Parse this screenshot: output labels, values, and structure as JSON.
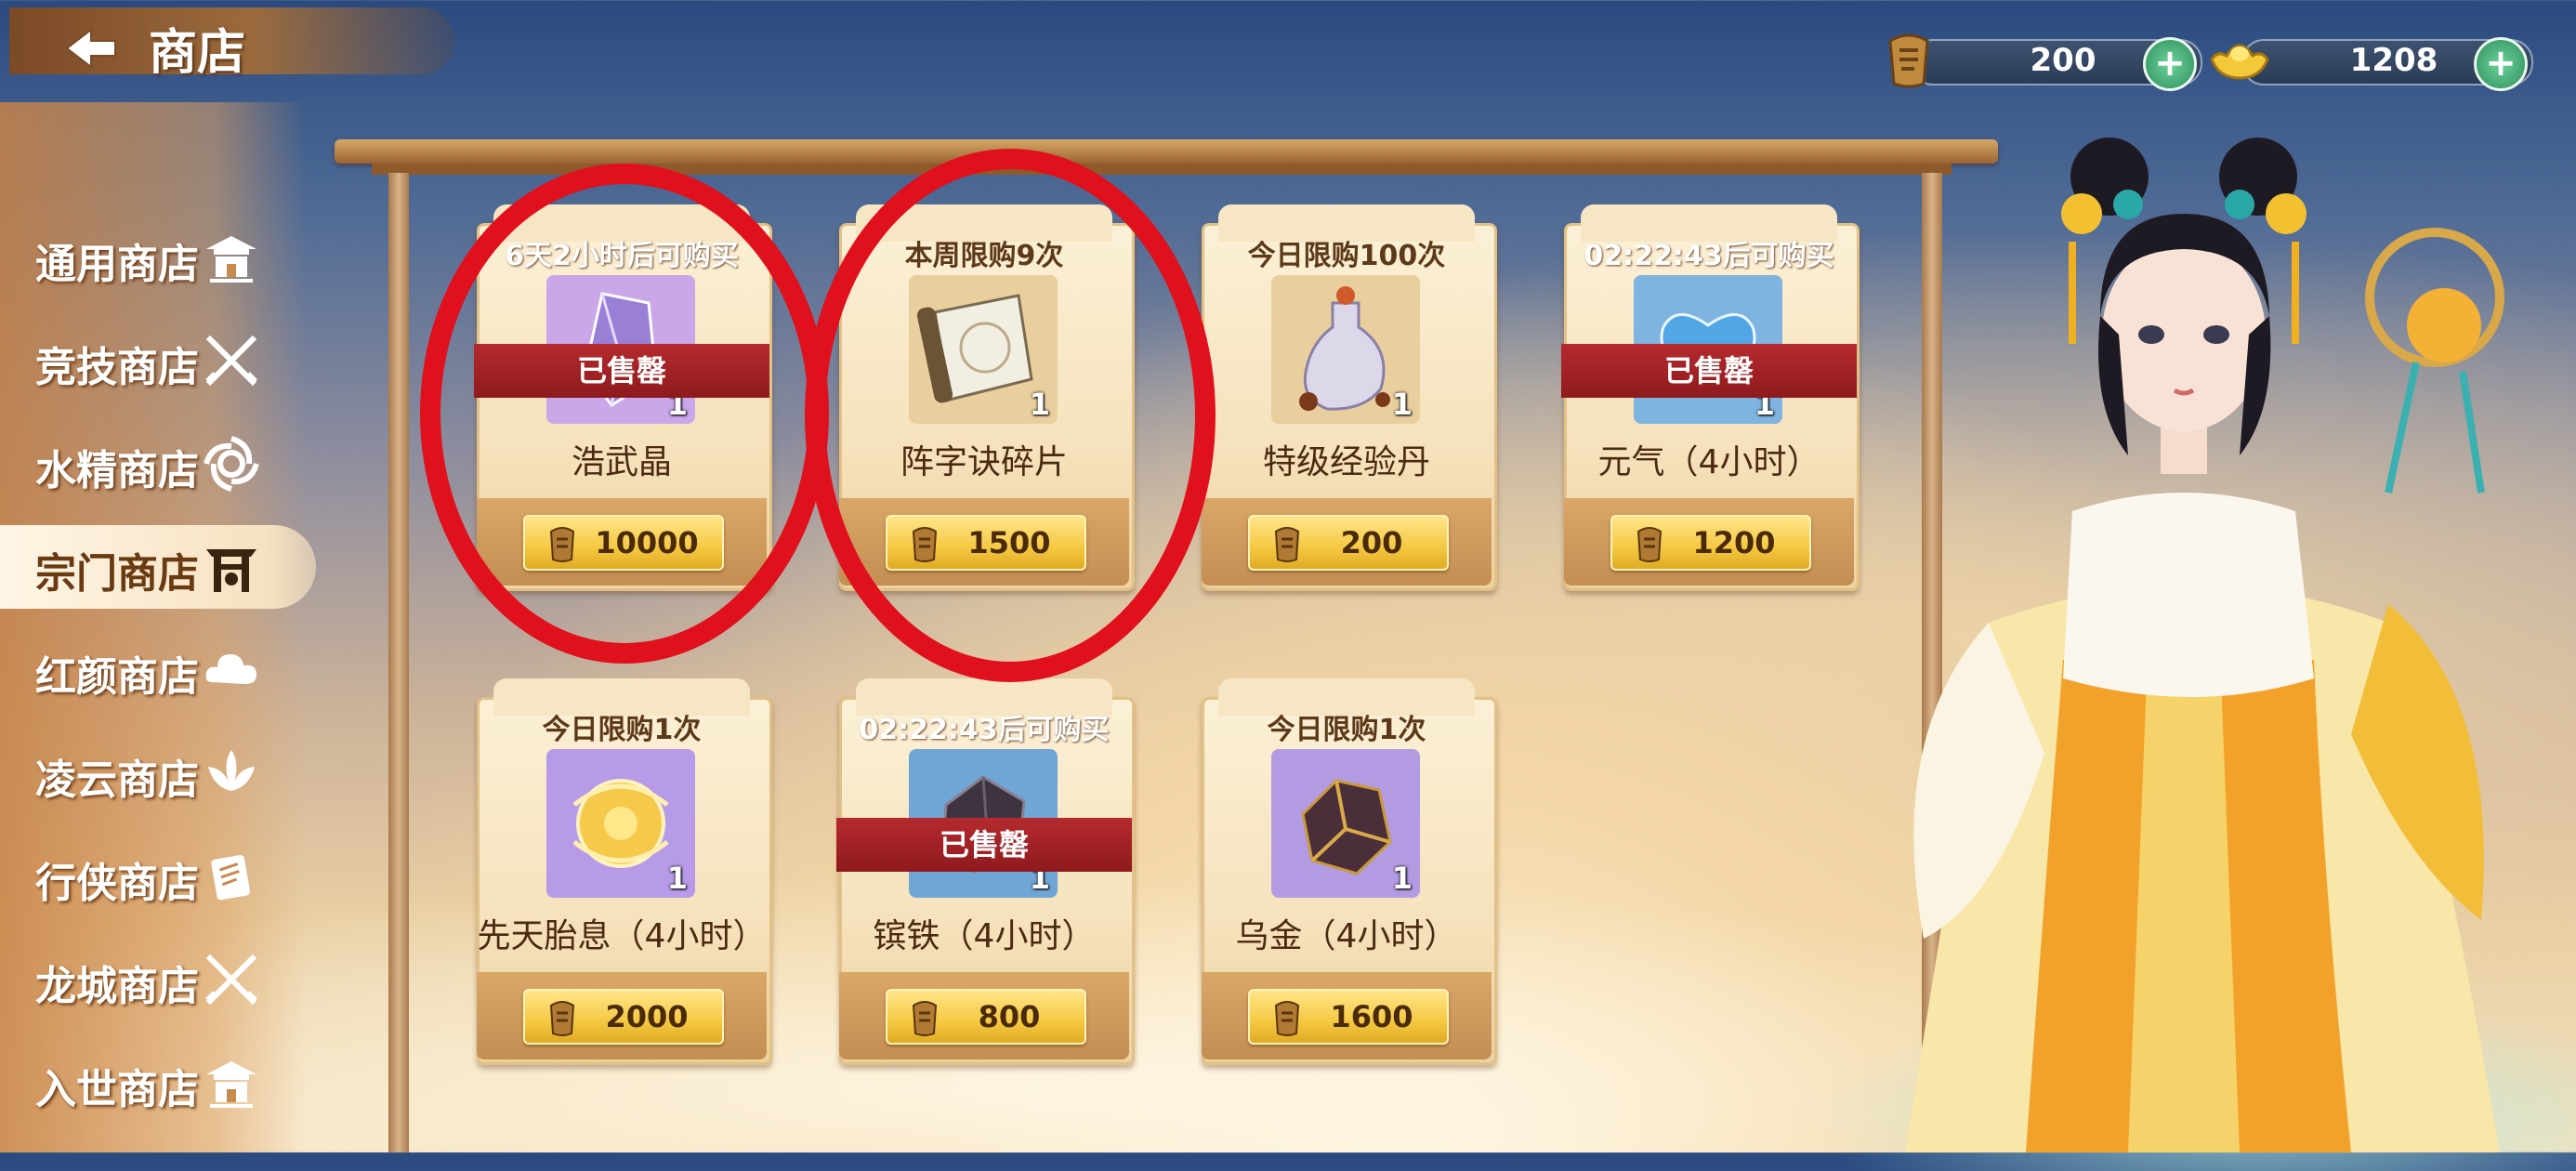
{
  "header": {
    "title": "商店"
  },
  "currencies": [
    {
      "icon": "token-icon",
      "value": "200"
    },
    {
      "icon": "gold-ingot-icon",
      "value": "1208"
    }
  ],
  "sidebar": {
    "items": [
      {
        "label": "通用商店",
        "icon": "pavilion-icon",
        "active": false
      },
      {
        "label": "竞技商店",
        "icon": "crossed-swords-icon",
        "active": false
      },
      {
        "label": "水精商店",
        "icon": "swirl-icon",
        "active": false
      },
      {
        "label": "宗门商店",
        "icon": "gate-icon",
        "active": true
      },
      {
        "label": "红颜商店",
        "icon": "cloud-icon",
        "active": false
      },
      {
        "label": "凌云商店",
        "icon": "lotus-icon",
        "active": false
      },
      {
        "label": "行侠商店",
        "icon": "scroll-icon",
        "active": false
      },
      {
        "label": "龙城商店",
        "icon": "crossed-swords-icon",
        "active": false
      },
      {
        "label": "入世商店",
        "icon": "pavilion-icon",
        "active": false
      }
    ]
  },
  "shop": {
    "items": [
      {
        "limit": "6天2小时后可购买",
        "limit_style": "white",
        "name": "浩武晶",
        "qty": "1",
        "price": "10000",
        "sold_out": true,
        "sold_out_label": "已售罄",
        "icon": "crystal-icon",
        "icon_bg": "#c9a7e8"
      },
      {
        "limit": "本周限购9次",
        "limit_style": "dark",
        "name": "阵字诀碎片",
        "qty": "1",
        "price": "1500",
        "sold_out": false,
        "sold_out_label": "",
        "icon": "scroll-fragment-icon",
        "icon_bg": "#e9cf9d"
      },
      {
        "limit": "今日限购100次",
        "limit_style": "dark",
        "name": "特级经验丹",
        "qty": "1",
        "price": "200",
        "sold_out": false,
        "sold_out_label": "",
        "icon": "potion-icon",
        "icon_bg": "#e9cf9d"
      },
      {
        "limit": "02:22:43后可购买",
        "limit_style": "white",
        "name": "元气（4小时）",
        "qty": "1",
        "price": "1200",
        "sold_out": true,
        "sold_out_label": "已售罄",
        "icon": "energy-icon",
        "icon_bg": "#7fb4e0"
      },
      {
        "limit": "今日限购1次",
        "limit_style": "dark",
        "name": "先天胎息（4小时）",
        "qty": "1",
        "price": "2000",
        "sold_out": false,
        "sold_out_label": "",
        "icon": "golden-orb-icon",
        "icon_bg": "#b79be8"
      },
      {
        "limit": "02:22:43后可购买",
        "limit_style": "white",
        "name": "镔铁（4小时）",
        "qty": "1",
        "price": "800",
        "sold_out": true,
        "sold_out_label": "已售罄",
        "icon": "iron-ore-icon",
        "icon_bg": "#6fa6d6"
      },
      {
        "limit": "今日限购1次",
        "limit_style": "dark",
        "name": "乌金（4小时）",
        "qty": "1",
        "price": "1600",
        "sold_out": false,
        "sold_out_label": "",
        "icon": "dark-gold-ore-icon",
        "icon_bg": "#b39be4"
      }
    ]
  },
  "annotations": {
    "highlight_color": "#e0101c"
  }
}
